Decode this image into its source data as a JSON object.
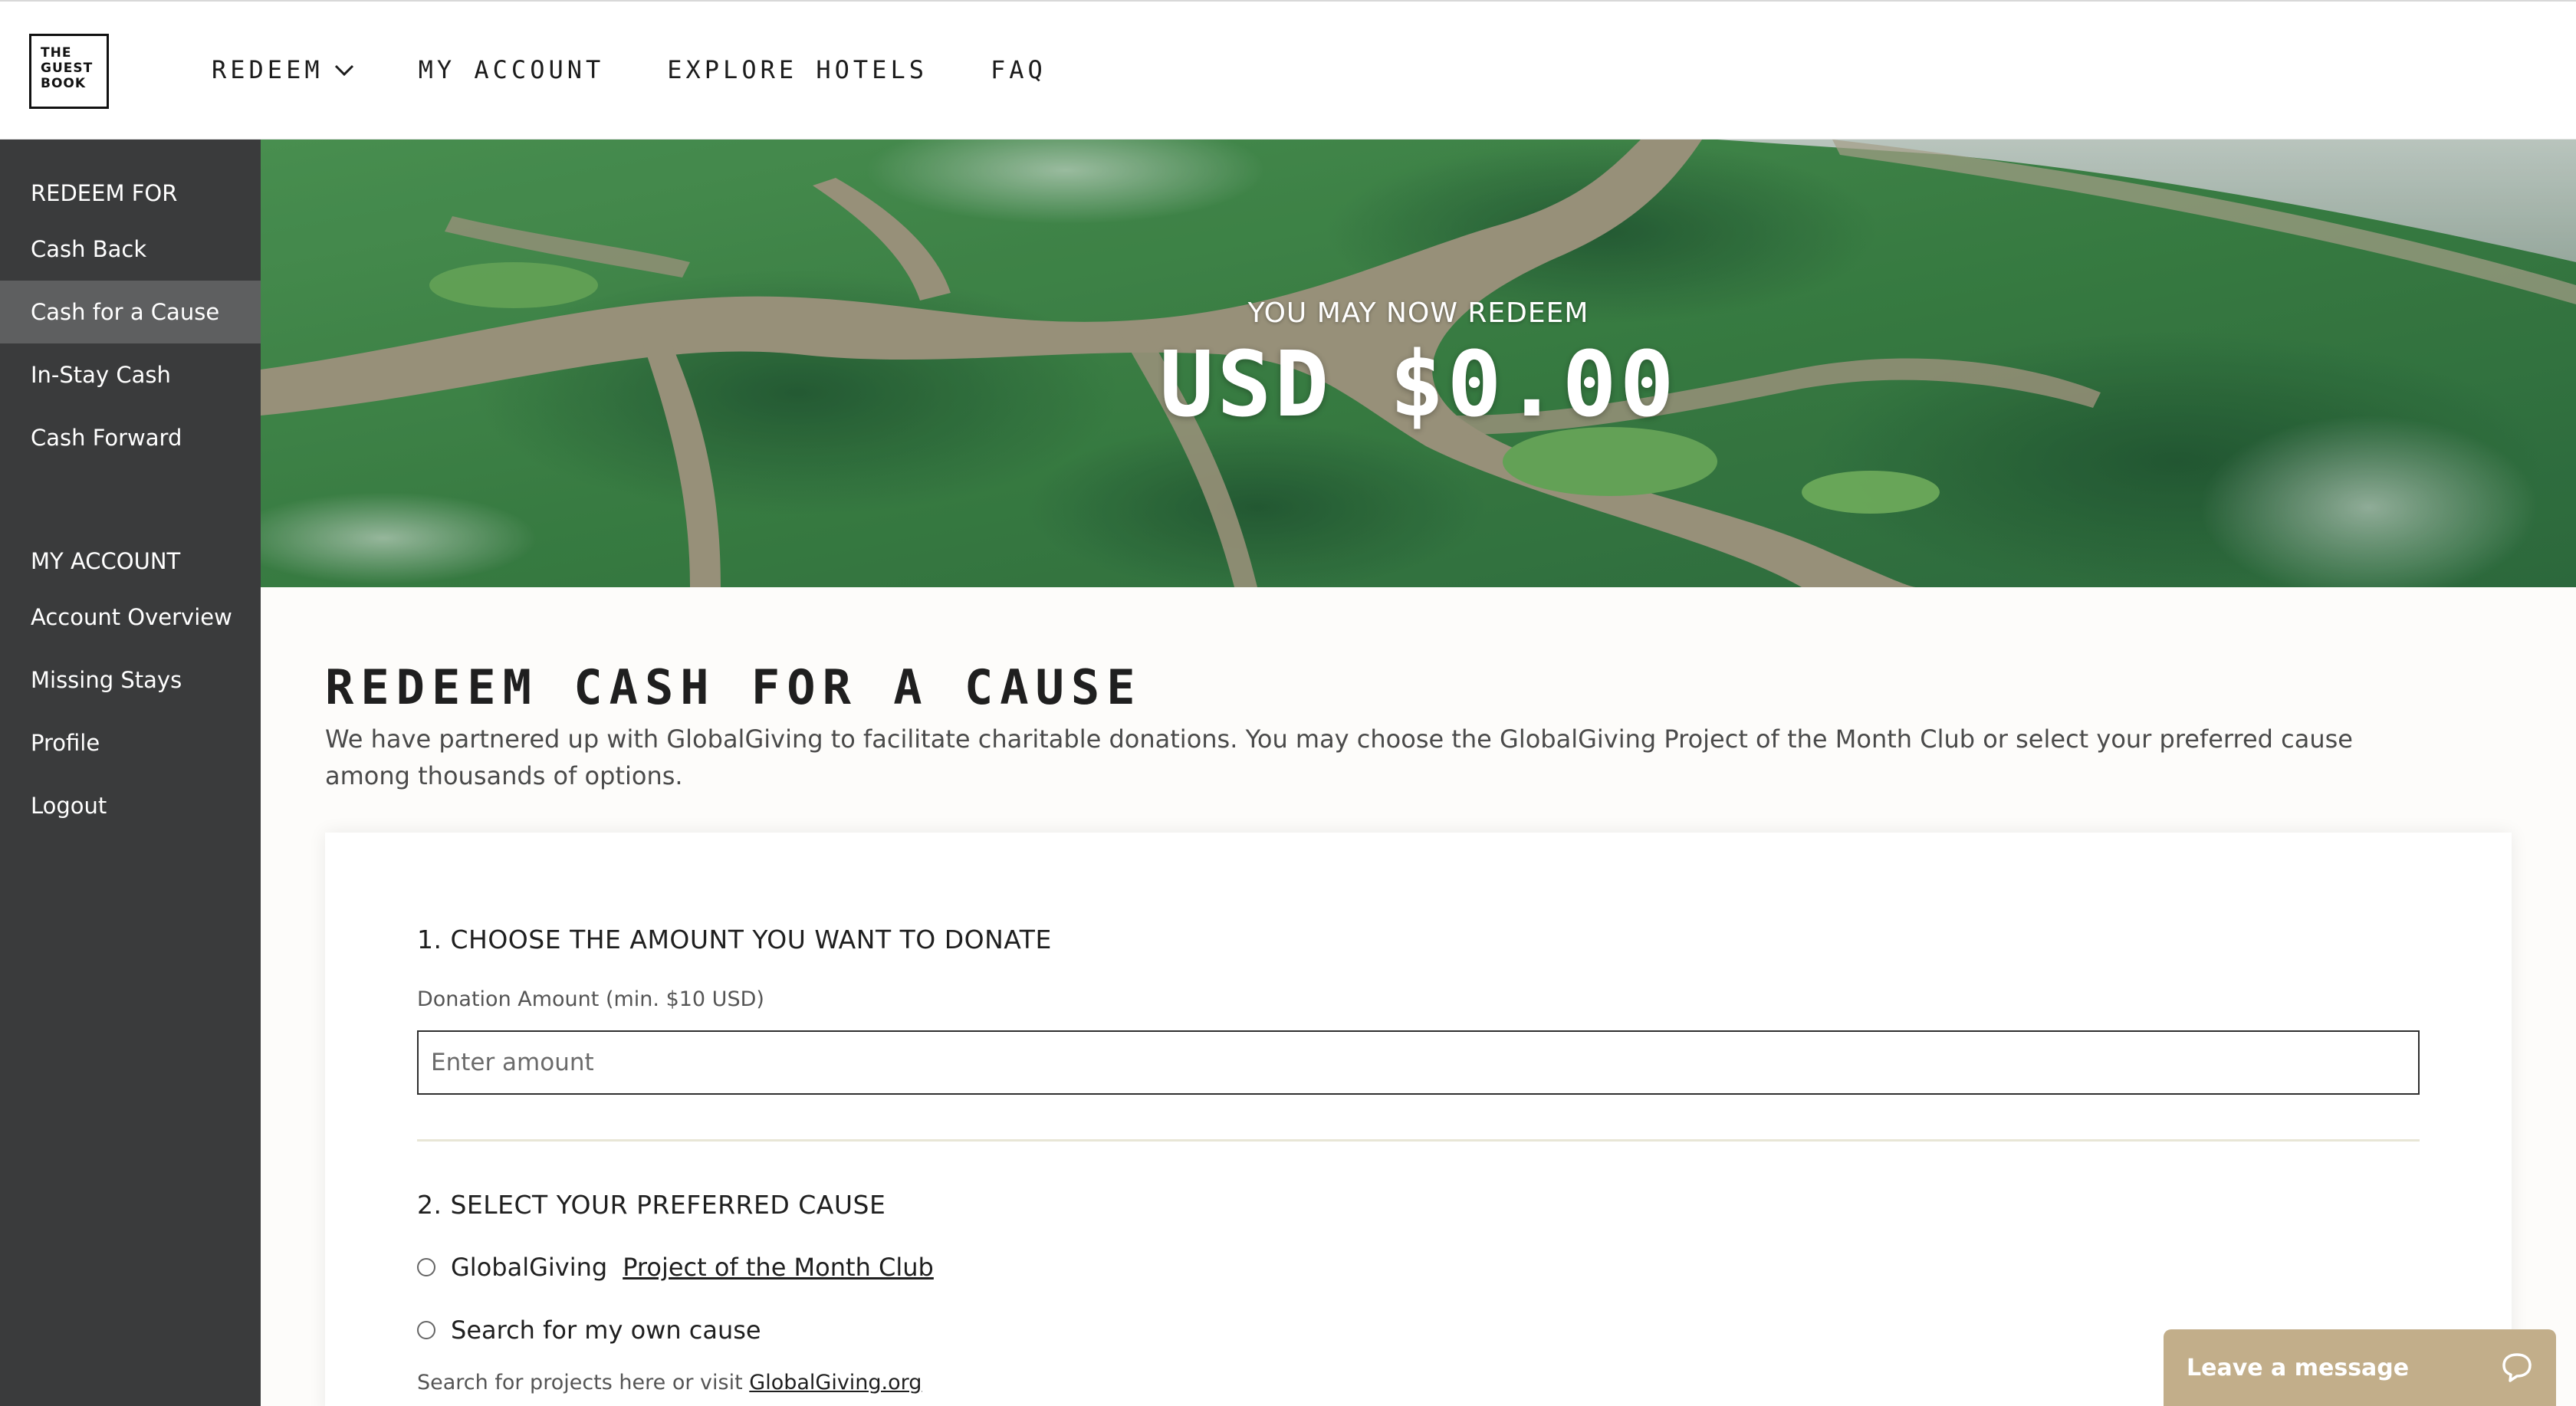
{
  "logo": {
    "line1": "THE",
    "line2": "GUEST",
    "line3": "BOOK"
  },
  "nav": {
    "redeem": "REDEEM",
    "my_account": "MY ACCOUNT",
    "explore_hotels": "EXPLORE HOTELS",
    "faq": "FAQ"
  },
  "sidebar": {
    "redeem_heading": "REDEEM FOR",
    "redeem_items": [
      "Cash Back",
      "Cash for a Cause",
      "In-Stay Cash",
      "Cash Forward"
    ],
    "active_item": "Cash for a Cause",
    "account_heading": "MY ACCOUNT",
    "account_items": [
      "Account Overview",
      "Missing Stays",
      "Profile",
      "Logout"
    ]
  },
  "hero": {
    "subtitle": "YOU MAY NOW REDEEM",
    "amount": "USD $0.00"
  },
  "main": {
    "title": "REDEEM CASH FOR A CAUSE",
    "intro": "We have partnered up with GlobalGiving to facilitate charitable donations. You may choose the GlobalGiving Project of the Month Club or select your preferred cause among thousands of options.",
    "step1": {
      "title": "1. CHOOSE THE AMOUNT YOU WANT TO DONATE",
      "label": "Donation Amount (min. $10 USD)",
      "placeholder": "Enter amount",
      "value": ""
    },
    "step2": {
      "title": "2. SELECT YOUR PREFERRED CAUSE",
      "option1_prefix": "GlobalGiving",
      "option1_link": "Project of the Month Club",
      "option2": "Search for my own cause",
      "hint_prefix": "Search for projects here or visit",
      "hint_link": "GlobalGiving.org"
    }
  },
  "chat": {
    "label": "Leave a message",
    "icon": "chat-bubble-icon"
  },
  "colors": {
    "sidebar_bg": "#3a3b3c",
    "sidebar_active": "#5e5f60",
    "chat_bg": "#c2ae8a",
    "page_bg": "#fdfcfa"
  }
}
